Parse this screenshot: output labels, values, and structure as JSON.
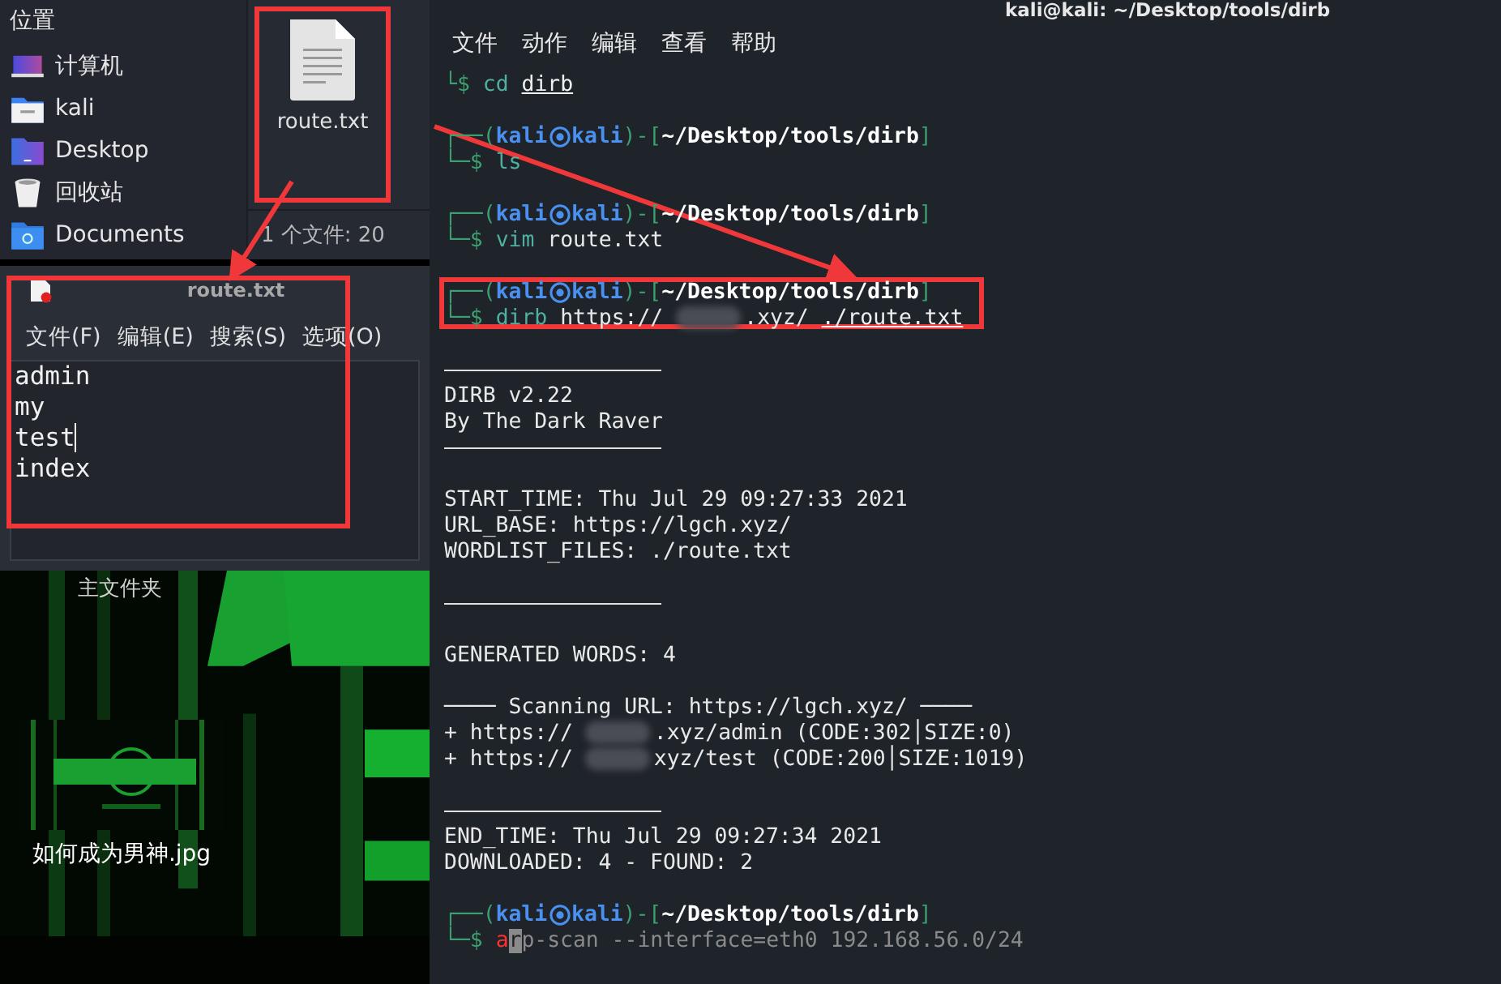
{
  "file_manager": {
    "sidebar": {
      "title": "位置",
      "items": [
        {
          "label": "计算机",
          "kind": "computer"
        },
        {
          "label": "kali",
          "kind": "home"
        },
        {
          "label": "Desktop",
          "kind": "desktop"
        },
        {
          "label": "回收站",
          "kind": "trash"
        },
        {
          "label": "Documents",
          "kind": "documents"
        }
      ]
    },
    "files": [
      {
        "name": "route.txt",
        "highlighted": true
      }
    ],
    "status_bar": "1 个文件: 20"
  },
  "editor": {
    "title": "route.txt",
    "highlighted": true,
    "menu": [
      "文件(F)",
      "编辑(E)",
      "搜索(S)",
      "选项(O)"
    ],
    "lines": [
      {
        "text": "admin",
        "caret": false
      },
      {
        "text": "my",
        "caret": false
      },
      {
        "text": "test",
        "caret": true
      },
      {
        "text": "index",
        "caret": false
      }
    ]
  },
  "desktop": {
    "folder_label": "主文件夹",
    "icons": [
      {
        "label": "如何成为男神.jpg",
        "kind": "picture"
      }
    ]
  },
  "terminal": {
    "title": "kali@kali: ~/Desktop/tools/dirb",
    "menu": [
      "文件",
      "动作",
      "编辑",
      "查看",
      "帮助"
    ],
    "lines": [
      {
        "kind": "command",
        "sign": "└$",
        "parts": [
          {
            "kind": "cmd",
            "text": "cd"
          },
          {
            "kind": "arg",
            "text": "dirb"
          }
        ]
      },
      {
        "kind": "blank"
      },
      {
        "kind": "prompt",
        "open": "┌──(",
        "user": "kali",
        "host": "kali",
        "mid": ")-[",
        "path": "~/Desktop/tools/dirb",
        "close": "]"
      },
      {
        "kind": "command",
        "sign": "└─$",
        "parts": [
          {
            "kind": "cmd",
            "text": "ls"
          }
        ]
      },
      {
        "kind": "blank"
      },
      {
        "kind": "prompt",
        "open": "┌──(",
        "user": "kali",
        "host": "kali",
        "mid": ")-[",
        "path": "~/Desktop/tools/dirb",
        "close": "]"
      },
      {
        "kind": "command",
        "sign": "└─$",
        "parts": [
          {
            "kind": "cmd",
            "text": "vim"
          },
          {
            "kind": "text",
            "text": "route.txt"
          }
        ]
      },
      {
        "kind": "blank"
      },
      {
        "kind": "prompt",
        "open": "┌──(",
        "user": "kali",
        "host": "kali",
        "mid": ")-[",
        "path": "~/Desktop/tools/dirb",
        "close": "]"
      },
      {
        "kind": "command",
        "sign": "└─$",
        "highlighted": true,
        "parts": [
          {
            "kind": "cmd",
            "text": "dirb"
          },
          {
            "kind": "text",
            "text": "https://"
          },
          {
            "kind": "redacted"
          },
          {
            "kind": "text",
            "text": ".xyz/"
          },
          {
            "kind": "arg",
            "text": "./route.txt"
          }
        ]
      },
      {
        "kind": "blank"
      },
      {
        "kind": "rule"
      },
      {
        "kind": "output",
        "parts": [
          {
            "kind": "text",
            "text": "DIRB v2.22"
          }
        ]
      },
      {
        "kind": "output",
        "parts": [
          {
            "kind": "text",
            "text": "By The Dark Raver"
          }
        ]
      },
      {
        "kind": "rule"
      },
      {
        "kind": "blank"
      },
      {
        "kind": "output",
        "parts": [
          {
            "kind": "text",
            "text": "START_TIME: Thu Jul 29 09:27:33 2021"
          }
        ]
      },
      {
        "kind": "output",
        "parts": [
          {
            "kind": "text",
            "text": "URL_BASE: https://lgch.xyz/"
          }
        ]
      },
      {
        "kind": "output",
        "parts": [
          {
            "kind": "text",
            "text": "WORDLIST_FILES: ./route.txt"
          }
        ]
      },
      {
        "kind": "blank"
      },
      {
        "kind": "rule"
      },
      {
        "kind": "blank"
      },
      {
        "kind": "output",
        "parts": [
          {
            "kind": "text",
            "text": "GENERATED WORDS: 4"
          }
        ]
      },
      {
        "kind": "blank"
      },
      {
        "kind": "output",
        "parts": [
          {
            "kind": "text",
            "text": "──── Scanning URL: https://lgch.xyz/ ────"
          }
        ]
      },
      {
        "kind": "output",
        "parts": [
          {
            "kind": "text",
            "text": "+ https://"
          },
          {
            "kind": "redacted"
          },
          {
            "kind": "text",
            "text": ".xyz/admin (CODE:302│SIZE:0)"
          }
        ]
      },
      {
        "kind": "output",
        "parts": [
          {
            "kind": "text",
            "text": "+ https://"
          },
          {
            "kind": "redacted"
          },
          {
            "kind": "text",
            "text": "xyz/test (CODE:200│SIZE:1019)"
          }
        ]
      },
      {
        "kind": "blank"
      },
      {
        "kind": "rule"
      },
      {
        "kind": "output",
        "parts": [
          {
            "kind": "text",
            "text": "END_TIME: Thu Jul 29 09:27:34 2021"
          }
        ]
      },
      {
        "kind": "output",
        "parts": [
          {
            "kind": "text",
            "text": "DOWNLOADED: 4 - FOUND: 2"
          }
        ]
      },
      {
        "kind": "blank"
      },
      {
        "kind": "prompt",
        "open": "┌──(",
        "user": "kali",
        "host": "kali",
        "mid": ")-[",
        "path": "~/Desktop/tools/dirb",
        "close": "]"
      },
      {
        "kind": "command",
        "sign": "└─$",
        "parts": [
          {
            "kind": "error",
            "text": "a"
          },
          {
            "kind": "cursor",
            "text": "r"
          },
          {
            "kind": "suggest",
            "text": "p-scan --interface=eth0 192.168.56.0/24"
          }
        ]
      }
    ]
  }
}
